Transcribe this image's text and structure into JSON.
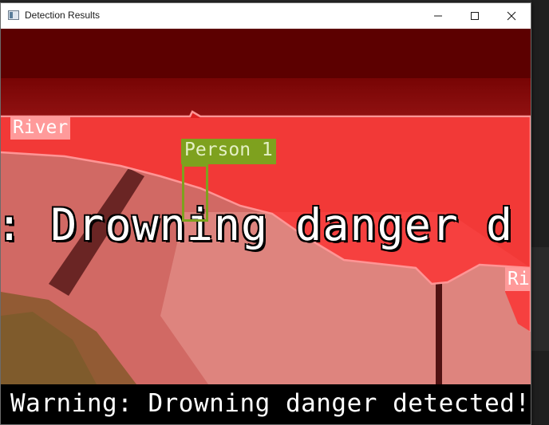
{
  "window": {
    "title": "Detection Results"
  },
  "detections": {
    "river_label": "River",
    "river_label_partial": "Riv",
    "person_label": "Person 1"
  },
  "overlay": {
    "alert_text": ": Drowning danger d"
  },
  "banner": {
    "text": "Warning: Drowning danger detected! Ove"
  },
  "colors": {
    "zone_overlay": "#ff3030",
    "zone_outline": "#ff9a9a",
    "person_box": "#7ea11e",
    "titlebar": "#ffffff"
  },
  "icons": {
    "app": "app-window-icon",
    "minimize": "minimize-icon",
    "maximize": "maximize-icon",
    "close": "close-icon"
  }
}
